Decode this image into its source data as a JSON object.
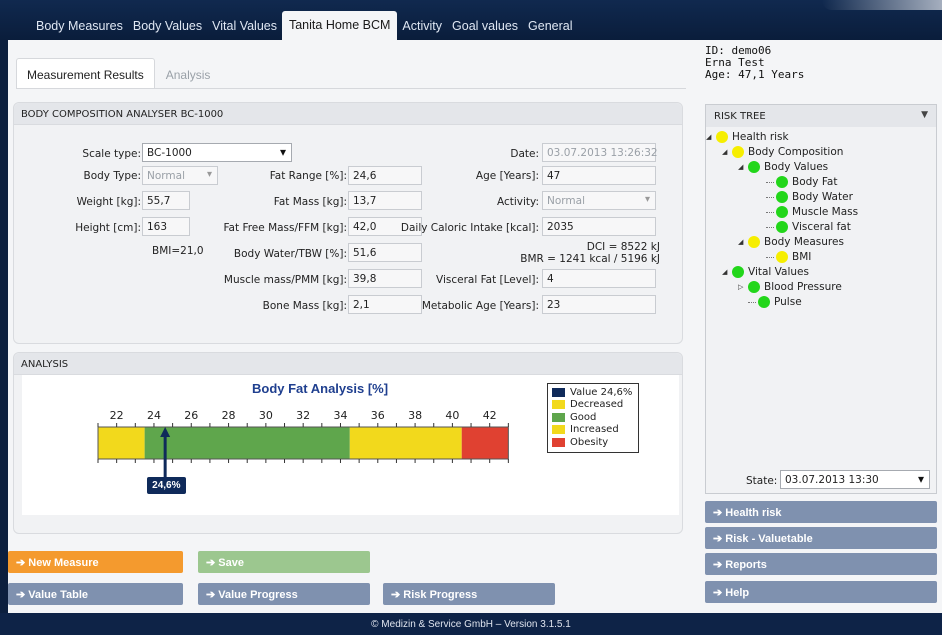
{
  "nav": {
    "tabs": [
      "Body Measures",
      "Body Values",
      "Vital Values",
      "Tanita Home BCM",
      "Activity",
      "Goal values",
      "General"
    ],
    "active_index": 3
  },
  "patient": {
    "id": "ID: demo06",
    "name": "Erna Test",
    "age": "Age: 47,1 Years"
  },
  "subtabs": {
    "results": "Measurement Results",
    "analysis": "Analysis"
  },
  "composition": {
    "title": "BODY COMPOSITION ANALYSER BC-1000",
    "scale_type_label": "Scale type:",
    "scale_type_value": "BC-1000",
    "body_type_label": "Body Type:",
    "body_type_value": "Normal",
    "weight_label": "Weight [kg]:",
    "weight_value": "55,7",
    "height_label": "Height [cm]:",
    "height_value": "163",
    "bmi": "BMI=21,0",
    "fat_range_label": "Fat Range [%]:",
    "fat_range_value": "24,6",
    "fat_mass_label": "Fat Mass [kg]:",
    "fat_mass_value": "13,7",
    "ffm_label": "Fat Free Mass/FFM [kg]:",
    "ffm_value": "42,0",
    "tbw_label": "Body Water/TBW [%]:",
    "tbw_value": "51,6",
    "pmm_label": "Muscle mass/PMM [kg]:",
    "pmm_value": "39,8",
    "bone_label": "Bone Mass [kg]:",
    "bone_value": "2,1",
    "date_label": "Date:",
    "date_value": "03.07.2013 13:26:32",
    "age_label": "Age [Years]:",
    "age_value": "47",
    "activity_label": "Activity:",
    "activity_value": "Normal",
    "dci_label": "Daily Caloric Intake [kcal]:",
    "dci_value": "2035",
    "dci_text": "DCI = 8522 kJ",
    "bmr_text": "BMR = 1241 kcal / 5196 kJ",
    "visceral_label": "Visceral Fat [Level]:",
    "visceral_value": "4",
    "metabolic_label": "Metabolic Age [Years]:",
    "metabolic_value": "23"
  },
  "analysis": {
    "title": "ANALYSIS"
  },
  "chart_data": {
    "type": "bar",
    "title": "Body Fat Analysis [%]",
    "xlim": [
      21,
      44
    ],
    "ticks": [
      22,
      24,
      26,
      28,
      30,
      32,
      34,
      36,
      38,
      40,
      42
    ],
    "segments": [
      {
        "name": "Decreased",
        "from": 21,
        "to": 23.5,
        "color": "#f2d91c"
      },
      {
        "name": "Good",
        "from": 23.5,
        "to": 34.5,
        "color": "#5fa64c"
      },
      {
        "name": "Increased",
        "from": 34.5,
        "to": 40.5,
        "color": "#f2d91c"
      },
      {
        "name": "Obesity",
        "from": 40.5,
        "to": 43,
        "color": "#e04131"
      }
    ],
    "value": 24.6,
    "value_label": "24,6%",
    "legend": [
      {
        "label": "Value 24,6%",
        "color": "#0f2a5a"
      },
      {
        "label": "Decreased",
        "color": "#f2d91c"
      },
      {
        "label": "Good",
        "color": "#5fa64c"
      },
      {
        "label": "Increased",
        "color": "#f2d91c"
      },
      {
        "label": "Obesity",
        "color": "#e04131"
      }
    ]
  },
  "risk_tree": {
    "title": "RISK TREE",
    "nodes": [
      {
        "label": "Health risk",
        "color": "yellow"
      },
      {
        "label": "Body Composition",
        "color": "yellow"
      },
      {
        "label": "Body Values",
        "color": "green"
      },
      {
        "label": "Body Fat",
        "color": "green"
      },
      {
        "label": "Body Water",
        "color": "green"
      },
      {
        "label": "Muscle Mass",
        "color": "green"
      },
      {
        "label": "Visceral fat",
        "color": "green"
      },
      {
        "label": "Body Measures",
        "color": "yellow"
      },
      {
        "label": "BMI",
        "color": "yellow"
      },
      {
        "label": "Vital Values",
        "color": "green"
      },
      {
        "label": "Blood Pressure",
        "color": "green"
      },
      {
        "label": "Pulse",
        "color": "green"
      }
    ],
    "state_label": "State:",
    "state_value": "03.07.2013 13:30"
  },
  "side_buttons": [
    "Health risk",
    "Risk - Valuetable",
    "Reports",
    "Help"
  ],
  "bottom_buttons": {
    "new_measure": "New Measure",
    "save": "Save",
    "value_table": "Value Table",
    "value_progress": "Value Progress",
    "risk_progress": "Risk Progress"
  },
  "colors": {
    "nav_bg": "#0c1f3e",
    "new_measure": "#f49a2e",
    "save": "#9cc78f",
    "button": "#7f91af"
  },
  "footer": "© Medizin & Service GmbH – Version 3.1.5.1"
}
